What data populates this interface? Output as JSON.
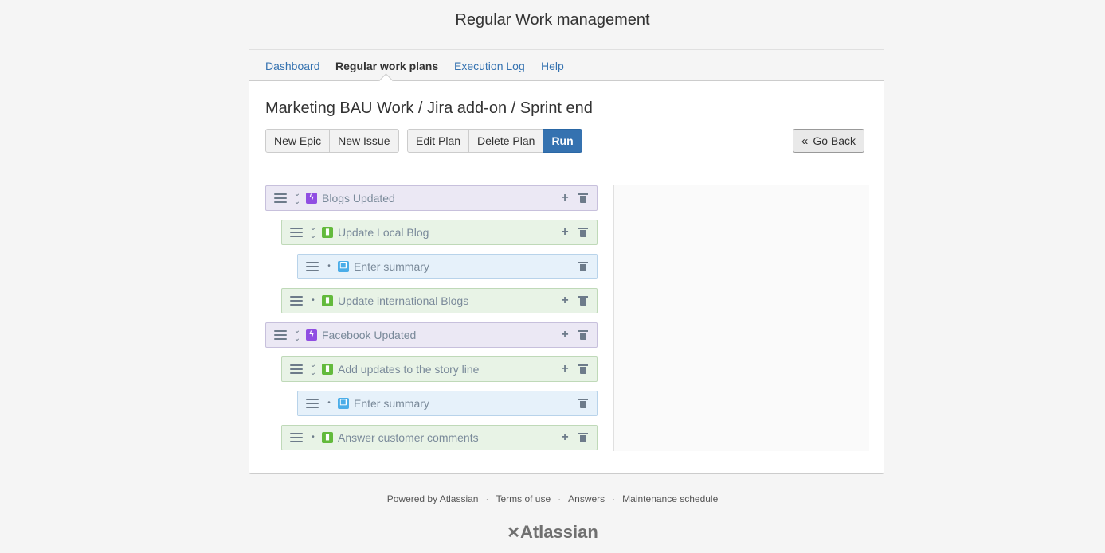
{
  "app_title": "Regular Work management",
  "nav": [
    {
      "label": "Dashboard",
      "active": false
    },
    {
      "label": "Regular work plans",
      "active": true
    },
    {
      "label": "Execution Log",
      "active": false
    },
    {
      "label": "Help",
      "active": false
    }
  ],
  "plan_title": "Marketing BAU Work / Jira add-on / Sprint end",
  "toolbar": {
    "new_epic": "New Epic",
    "new_issue": "New Issue",
    "edit_plan": "Edit Plan",
    "delete_plan": "Delete Plan",
    "run": "Run",
    "go_back": "Go Back"
  },
  "tree": [
    {
      "label": "Blogs Updated",
      "type": "epic",
      "expanded": true
    },
    {
      "label": "Update Local Blog",
      "type": "story",
      "expanded": true
    },
    {
      "label": "Enter summary",
      "type": "subtask",
      "expanded": false
    },
    {
      "label": "Update international Blogs",
      "type": "story",
      "expanded": false
    },
    {
      "label": "Facebook Updated",
      "type": "epic",
      "expanded": true
    },
    {
      "label": "Add updates to the story line",
      "type": "story",
      "expanded": true
    },
    {
      "label": "Enter summary",
      "type": "subtask",
      "expanded": false
    },
    {
      "label": "Answer customer comments",
      "type": "story",
      "expanded": false
    }
  ],
  "footer": {
    "powered_by": "Powered by Atlassian",
    "terms": "Terms of use",
    "answers": "Answers",
    "maintenance": "Maintenance schedule",
    "separator": "·"
  },
  "logo": "Atlassian",
  "colors": {
    "accent": "#3572b0",
    "epic": "#904ee2",
    "story": "#63ba3c",
    "subtask": "#4bade8"
  }
}
